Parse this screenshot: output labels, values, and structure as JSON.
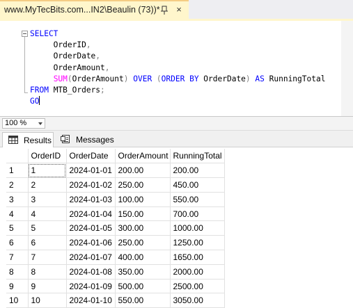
{
  "tab": {
    "title": "www.MyTecBits.com...IN2\\Beaulin (73))*",
    "pin_icon": "pin-icon",
    "close_glyph": "×"
  },
  "editor": {
    "lines": [
      [
        {
          "t": "SELECT",
          "c": "kw"
        }
      ],
      [
        {
          "t": "     OrderID",
          "c": "id"
        },
        {
          "t": ",",
          "c": "op"
        }
      ],
      [
        {
          "t": "     OrderDate",
          "c": "id"
        },
        {
          "t": ",",
          "c": "op"
        }
      ],
      [
        {
          "t": "     OrderAmount",
          "c": "id"
        },
        {
          "t": ",",
          "c": "op"
        }
      ],
      [
        {
          "t": "     ",
          "c": "id"
        },
        {
          "t": "SUM",
          "c": "fn"
        },
        {
          "t": "(",
          "c": "op"
        },
        {
          "t": "OrderAmount",
          "c": "id"
        },
        {
          "t": ")",
          "c": "op"
        },
        {
          "t": " OVER ",
          "c": "kw"
        },
        {
          "t": "(",
          "c": "op"
        },
        {
          "t": "ORDER BY ",
          "c": "kw"
        },
        {
          "t": "OrderDate",
          "c": "id"
        },
        {
          "t": ")",
          "c": "op"
        },
        {
          "t": " AS ",
          "c": "kw"
        },
        {
          "t": "RunningTotal",
          "c": "id"
        }
      ],
      [
        {
          "t": "FROM ",
          "c": "kw"
        },
        {
          "t": "MTB_Orders",
          "c": "id"
        },
        {
          "t": ";",
          "c": "op"
        }
      ],
      [
        {
          "t": "GO",
          "c": "kw"
        }
      ]
    ]
  },
  "zoom": {
    "value": "100 %"
  },
  "results_tabs": [
    {
      "label": "Results",
      "icon": "grid-icon",
      "active": true
    },
    {
      "label": "Messages",
      "icon": "messages-icon",
      "active": false
    }
  ],
  "grid": {
    "columns": [
      "",
      "OrderID",
      "OrderDate",
      "OrderAmount",
      "RunningTotal"
    ],
    "rows": [
      [
        "1",
        "1",
        "2024-01-01",
        "200.00",
        "200.00"
      ],
      [
        "2",
        "2",
        "2024-01-02",
        "250.00",
        "450.00"
      ],
      [
        "3",
        "3",
        "2024-01-03",
        "100.00",
        "550.00"
      ],
      [
        "4",
        "4",
        "2024-01-04",
        "150.00",
        "700.00"
      ],
      [
        "5",
        "5",
        "2024-01-05",
        "300.00",
        "1000.00"
      ],
      [
        "6",
        "6",
        "2024-01-06",
        "250.00",
        "1250.00"
      ],
      [
        "7",
        "7",
        "2024-01-07",
        "400.00",
        "1650.00"
      ],
      [
        "8",
        "8",
        "2024-01-08",
        "350.00",
        "2000.00"
      ],
      [
        "9",
        "9",
        "2024-01-09",
        "500.00",
        "2500.00"
      ],
      [
        "10",
        "10",
        "2024-01-10",
        "550.00",
        "3050.00"
      ]
    ]
  }
}
